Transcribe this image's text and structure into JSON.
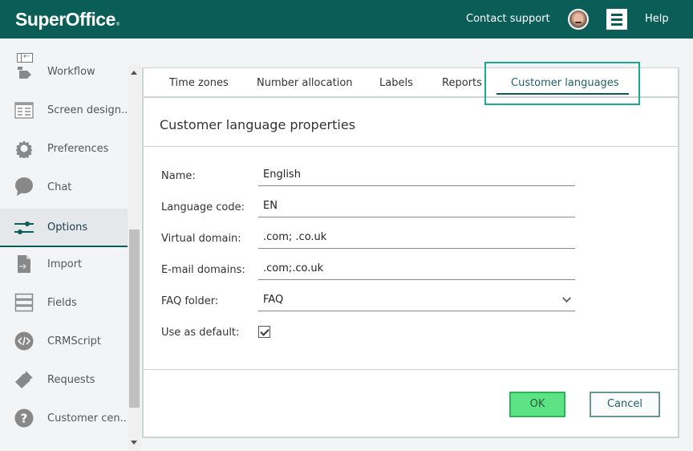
{
  "header": {
    "logo": "SuperOffice",
    "logo_mark": "®",
    "contact_support": "Contact support",
    "help": "Help",
    "avatar_icon": "user-avatar",
    "menu_icon": "hamburger-menu-icon"
  },
  "sidebar": {
    "collapse_icon": "collapse-sidebar-icon",
    "items": [
      {
        "label": "Workflow",
        "icon": "workflow-icon"
      },
      {
        "label": "Screen design...",
        "icon": "screen-design-icon"
      },
      {
        "label": "Preferences",
        "icon": "gear-icon"
      },
      {
        "label": "Chat",
        "icon": "chat-bubble-icon"
      },
      {
        "label": "Options",
        "icon": "sliders-icon",
        "active": true
      },
      {
        "label": "Import",
        "icon": "import-file-icon"
      },
      {
        "label": "Fields",
        "icon": "fields-icon"
      },
      {
        "label": "CRMScript",
        "icon": "code-icon"
      },
      {
        "label": "Requests",
        "icon": "ticket-icon"
      },
      {
        "label": "Customer cen...",
        "icon": "question-icon"
      }
    ]
  },
  "tabs": [
    {
      "label": "Time zones"
    },
    {
      "label": "Number allocation"
    },
    {
      "label": "Labels"
    },
    {
      "label": "Reports"
    },
    {
      "label": "Customer languages",
      "active": true
    }
  ],
  "form": {
    "title": "Customer language properties",
    "fields": [
      {
        "label": "Name:",
        "value": "English"
      },
      {
        "label": "Language code:",
        "value": "EN"
      },
      {
        "label": "Virtual domain:",
        "value": ".com; .co.uk"
      },
      {
        "label": "E-mail domains:",
        "value": ".com;.co.uk"
      },
      {
        "label": "FAQ folder:",
        "value": "FAQ",
        "type": "select"
      }
    ],
    "default_label": "Use as default:",
    "default_checked": true,
    "ok_label": "OK",
    "cancel_label": "Cancel"
  },
  "colors": {
    "header_bg": "#0b5e57",
    "accent": "#0b5e57",
    "highlight_box": "#18ab8c",
    "ok_button": "#5ce383"
  }
}
